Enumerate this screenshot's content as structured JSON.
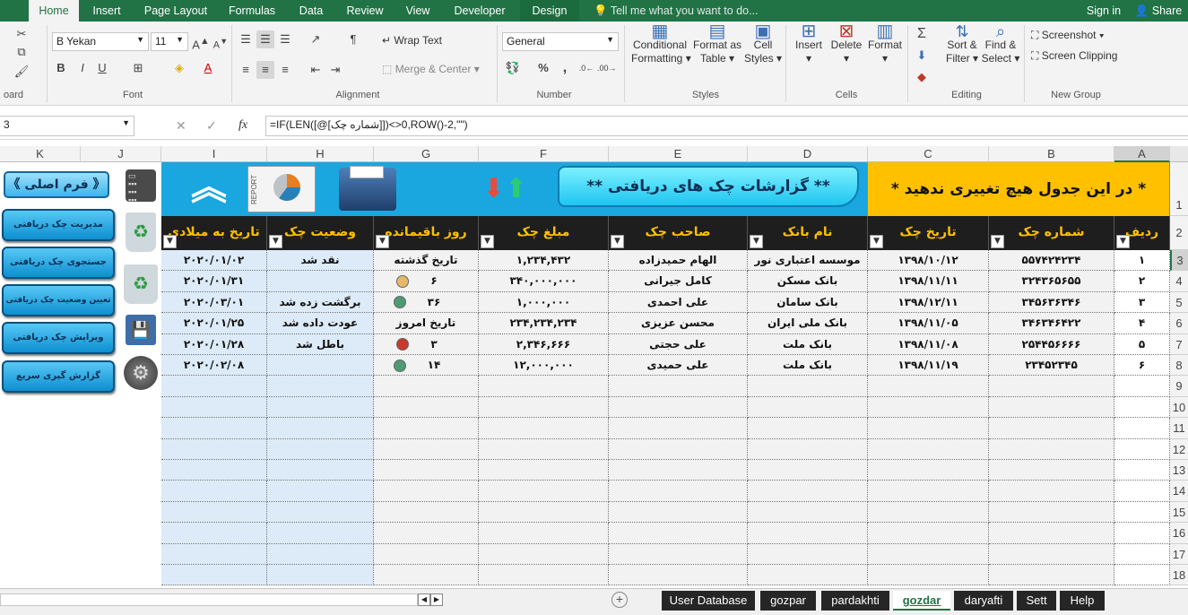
{
  "tabs": {
    "file": "",
    "home": "Home",
    "insert": "Insert",
    "page_layout": "Page Layout",
    "formulas": "Formulas",
    "data": "Data",
    "review": "Review",
    "view": "View",
    "developer": "Developer",
    "design": "Design",
    "tell_me": "Tell me what you want to do...",
    "sign_in": "Sign in",
    "share": "Share"
  },
  "ribbon": {
    "clipboard_label": "oard",
    "font_label": "Font",
    "font_name": "B Yekan",
    "font_size": "11",
    "alignment_label": "Alignment",
    "wrap_text": "Wrap Text",
    "merge_center": "Merge & Center",
    "number_label": "Number",
    "number_format": "General",
    "styles_label": "Styles",
    "conditional_formatting": "Conditional",
    "conditional_formatting2": "Formatting",
    "format_as_table": "Format as",
    "format_as_table2": "Table",
    "cell_styles": "Cell",
    "cell_styles2": "Styles",
    "cells_label": "Cells",
    "insert": "Insert",
    "delete": "Delete",
    "format": "Format",
    "editing_label": "Editing",
    "sort_filter": "Sort &",
    "sort_filter2": "Filter",
    "find_select": "Find &",
    "find_select2": "Select",
    "new_group_label": "New Group",
    "screenshot": "Screenshot",
    "screen_clipping": "Screen Clipping"
  },
  "formula_bar": {
    "name_box": "3",
    "formula": "=IF(LEN([@[شماره چک]])<>0,ROW()-2,\"\")"
  },
  "columns": [
    "K",
    "J",
    "I",
    "H",
    "G",
    "F",
    "E",
    "D",
    "C",
    "B",
    "A"
  ],
  "rows": [
    "1",
    "2",
    "3",
    "4",
    "5",
    "6",
    "7",
    "8",
    "9",
    "10",
    "11",
    "12",
    "13",
    "14",
    "15",
    "16",
    "17",
    "18"
  ],
  "banner": {
    "warning": "* در این جدول هیچ تغییری ندهید *",
    "report_title": "** گزارشات چک های دریافتی **",
    "report_icon_text": "REPORT"
  },
  "sidebar": {
    "main_form": "《 فرم اصلی 》",
    "buttons": [
      "مدیریت چک دریافتی",
      "جستجوی چک دریافتی",
      "تعیین وضعیت چک دریافتی",
      "ویرایش چک دریافتی",
      "گزارش گیری سریع"
    ]
  },
  "table": {
    "headers": {
      "radif": "ردیف",
      "check_no": "شماره چک",
      "check_date": "تاریخ چک",
      "bank": "نام بانک",
      "owner": "صاحب چک",
      "amount": "مبلغ چک",
      "days_left": "روز باقیمانده",
      "status": "وضعیت چک",
      "gregorian": "تاریخ به میلادی"
    },
    "rows": [
      {
        "radif": "۱",
        "check_no": "۵۵۷۴۲۴۲۳۴",
        "check_date": "۱۳۹۸/۱۰/۱۲",
        "bank": "موسسه اعتباری نور",
        "owner": "الهام حمیدزاده",
        "amount": "۱,۲۳۴,۴۳۲",
        "days_left": "تاریخ گذشته",
        "dot": "",
        "status": "نقد شد",
        "gregorian": "۲۰۲۰/۰۱/۰۲"
      },
      {
        "radif": "۲",
        "check_no": "۳۲۴۳۶۵۶۵۵",
        "check_date": "۱۳۹۸/۱۱/۱۱",
        "bank": "بانک مسکن",
        "owner": "کامل جیرانی",
        "amount": "۳۴۰,۰۰۰,۰۰۰",
        "days_left": "۶",
        "dot": "#e8b86a",
        "status": "",
        "gregorian": "۲۰۲۰/۰۱/۳۱"
      },
      {
        "radif": "۳",
        "check_no": "۳۴۵۶۳۶۳۴۶",
        "check_date": "۱۳۹۸/۱۲/۱۱",
        "bank": "بانک سامان",
        "owner": "علی احمدی",
        "amount": "۱,۰۰۰,۰۰۰",
        "days_left": "۳۶",
        "dot": "#4e9a75",
        "status": "برگشت زده شد",
        "gregorian": "۲۰۲۰/۰۳/۰۱"
      },
      {
        "radif": "۴",
        "check_no": "۳۴۶۳۴۶۴۲۲",
        "check_date": "۱۳۹۸/۱۱/۰۵",
        "bank": "بانک ملی ایران",
        "owner": "محسن عزیزی",
        "amount": "۲۳۴,۲۳۴,۲۳۴",
        "days_left": "تاریخ امروز",
        "dot": "",
        "status": "عودت داده شد",
        "gregorian": "۲۰۲۰/۰۱/۲۵"
      },
      {
        "radif": "۵",
        "check_no": "۲۵۴۴۵۶۶۶۶",
        "check_date": "۱۳۹۸/۱۱/۰۸",
        "bank": "بانک ملت",
        "owner": "علی حجتی",
        "amount": "۲,۳۴۶,۶۶۶",
        "days_left": "۳",
        "dot": "#c9392e",
        "status": "باطل شد",
        "gregorian": "۲۰۲۰/۰۱/۲۸"
      },
      {
        "radif": "۶",
        "check_no": "۲۳۴۵۲۳۴۵",
        "check_date": "۱۳۹۸/۱۱/۱۹",
        "bank": "بانک ملت",
        "owner": "علی حمیدی",
        "amount": "۱۲,۰۰۰,۰۰۰",
        "days_left": "۱۴",
        "dot": "#4e9a75",
        "status": "",
        "gregorian": "۲۰۲۰/۰۲/۰۸"
      }
    ]
  },
  "sheet_tabs": [
    "User Database",
    "gozpar",
    "pardakhti",
    "gozdar",
    "daryafti",
    "Sett",
    "Help"
  ],
  "active_sheet": "gozdar",
  "colors": {
    "excel_green": "#217346",
    "header_bg": "#1e1e1e",
    "header_text": "#ffc000",
    "banner_yellow": "#ffc000",
    "banner_blue": "#1aa7e0",
    "light_blue_col": "#dcebf7"
  }
}
